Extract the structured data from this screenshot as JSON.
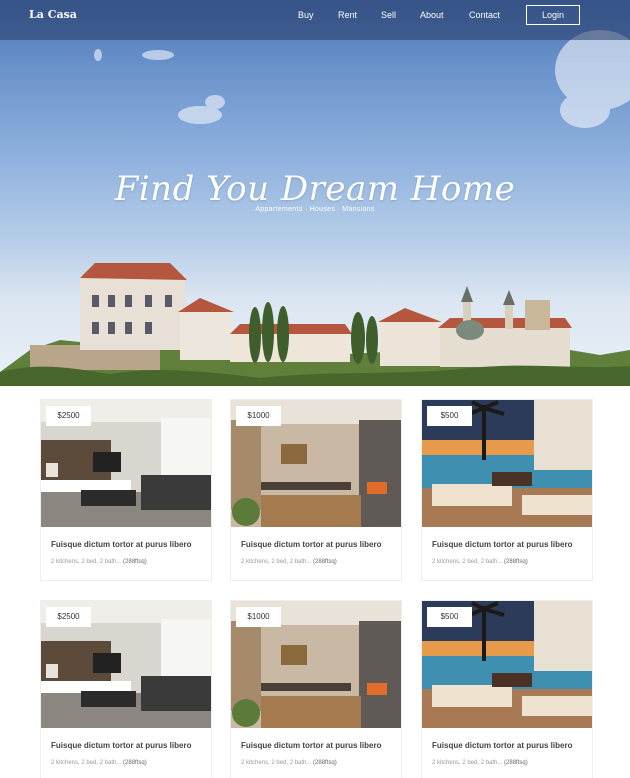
{
  "brand": {
    "name": "La Casa"
  },
  "nav": {
    "items": [
      {
        "id": "buy",
        "label": "Buy"
      },
      {
        "id": "rent",
        "label": "Rent"
      },
      {
        "id": "sell",
        "label": "Sell"
      },
      {
        "id": "about",
        "label": "About"
      },
      {
        "id": "contact",
        "label": "Contact"
      }
    ],
    "login_label": "Login"
  },
  "hero": {
    "headline": "Find You Dream Home",
    "subtitle": "Appartements · Houses · Mansions"
  },
  "listings": [
    {
      "price": "$2500",
      "title": "Fuisque dictum tortor at purus libero",
      "desc": "2 kitchens, 2 bed, 2 bath... ",
      "sqft": "(288ftsq)",
      "photo": "living-room-photo"
    },
    {
      "price": "$1000",
      "title": "Fuisque dictum tortor at purus libero",
      "desc": "2 kitchens, 2 bed, 2 bath... ",
      "sqft": "(288ftsq)",
      "photo": "dining-room-photo"
    },
    {
      "price": "$500",
      "title": "Fuisque dictum tortor at purus libero",
      "desc": "2 kitchens, 2 bed, 2 bath... ",
      "sqft": "(288ftsq)",
      "photo": "pool-terrace-photo"
    },
    {
      "price": "$2500",
      "title": "Fuisque dictum tortor at purus libero",
      "desc": "2 kitchens, 2 bed, 2 bath... ",
      "sqft": "(288ftsq)",
      "photo": "living-room-photo"
    },
    {
      "price": "$1000",
      "title": "Fuisque dictum tortor at purus libero",
      "desc": "2 kitchens, 2 bed, 2 bath... ",
      "sqft": "(288ftsq)",
      "photo": "dining-room-photo"
    },
    {
      "price": "$500",
      "title": "Fuisque dictum tortor at purus libero",
      "desc": "2 kitchens, 2 bed, 2 bath... ",
      "sqft": "(288ftsq)",
      "photo": "pool-terrace-photo"
    }
  ],
  "colors": {
    "nav_bar": "#263a64",
    "sky": "#6b93cc",
    "card_border": "#eeeeee"
  }
}
